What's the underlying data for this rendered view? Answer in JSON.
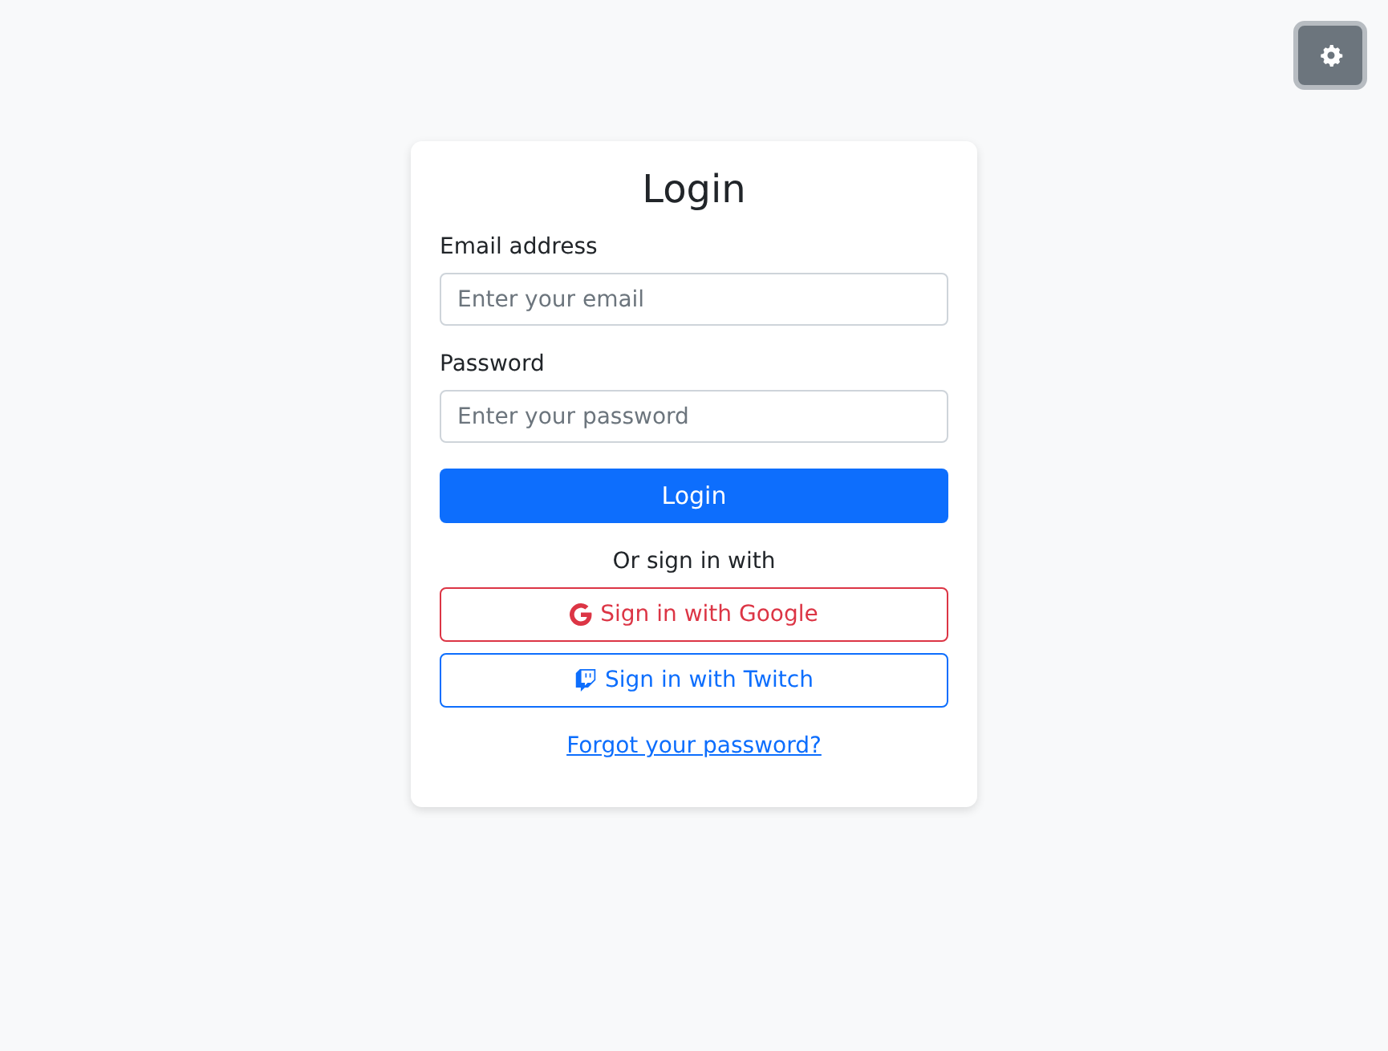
{
  "title": "Login",
  "fields": [
    {
      "label": "Email address",
      "placeholder": "Enter your email"
    },
    {
      "label": "Password",
      "placeholder": "Enter your password"
    }
  ],
  "submit": "Login",
  "divider": "Or sign in with",
  "social": [
    {
      "kind": "google",
      "label": "Sign in with Google"
    },
    {
      "kind": "twitch",
      "label": "Sign in with Twitch"
    }
  ],
  "forgot": "Forgot your password?"
}
